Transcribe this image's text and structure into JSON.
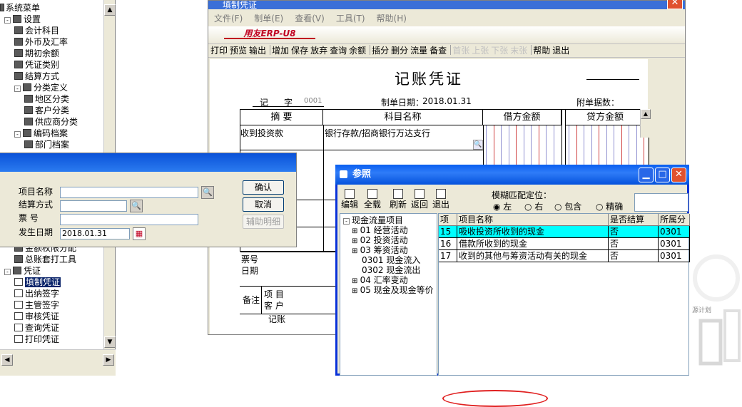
{
  "tree": {
    "root": "系统菜单",
    "items": [
      {
        "label": "设置",
        "indent": 0,
        "type": "folder",
        "expander": "-"
      },
      {
        "label": "会计科目",
        "indent": 1,
        "type": "item"
      },
      {
        "label": "外币及汇率",
        "indent": 1,
        "type": "item"
      },
      {
        "label": "期初余额",
        "indent": 1,
        "type": "item"
      },
      {
        "label": "凭证类别",
        "indent": 1,
        "type": "item"
      },
      {
        "label": "结算方式",
        "indent": 1,
        "type": "item"
      },
      {
        "label": "分类定义",
        "indent": 1,
        "type": "folder",
        "expander": "-"
      },
      {
        "label": "地区分类",
        "indent": 2,
        "type": "item"
      },
      {
        "label": "客户分类",
        "indent": 2,
        "type": "item"
      },
      {
        "label": "供应商分类",
        "indent": 2,
        "type": "item"
      },
      {
        "label": "编码档案",
        "indent": 1,
        "type": "folder",
        "expander": "-"
      },
      {
        "label": "部门档案",
        "indent": 2,
        "type": "item"
      }
    ],
    "lower_items": [
      {
        "label": "金额权限分配",
        "indent": 1,
        "type": "item"
      },
      {
        "label": "总账套打工具",
        "indent": 1,
        "type": "item"
      },
      {
        "label": "凭证",
        "indent": 0,
        "type": "folder",
        "expander": "-"
      },
      {
        "label": "填制凭证",
        "indent": 1,
        "type": "doc",
        "selected": true
      },
      {
        "label": "出纳签字",
        "indent": 1,
        "type": "doc"
      },
      {
        "label": "主管签字",
        "indent": 1,
        "type": "doc"
      },
      {
        "label": "审核凭证",
        "indent": 1,
        "type": "doc"
      },
      {
        "label": "查询凭证",
        "indent": 1,
        "type": "doc"
      },
      {
        "label": "打印凭证",
        "indent": 1,
        "type": "doc"
      }
    ]
  },
  "voucher_window": {
    "title": "填制凭证",
    "menu": [
      "文件(F)",
      "制单(E)",
      "查看(V)",
      "工具(T)",
      "帮助(H)"
    ],
    "brand": "用友ERP-U8",
    "toolbar": [
      {
        "label": "打印",
        "enabled": true
      },
      {
        "label": "预览",
        "enabled": true
      },
      {
        "label": "输出",
        "enabled": true
      },
      {
        "label": "增加",
        "enabled": true
      },
      {
        "label": "保存",
        "enabled": true
      },
      {
        "label": "放弃",
        "enabled": true
      },
      {
        "label": "查询",
        "enabled": true
      },
      {
        "label": "余额",
        "enabled": true
      },
      {
        "label": "插分",
        "enabled": true
      },
      {
        "label": "删分",
        "enabled": true
      },
      {
        "label": "流量",
        "enabled": true
      },
      {
        "label": "备查",
        "enabled": true
      },
      {
        "label": "首张",
        "enabled": false
      },
      {
        "label": "上张",
        "enabled": false
      },
      {
        "label": "下张",
        "enabled": false
      },
      {
        "label": "末张",
        "enabled": false
      },
      {
        "label": "帮助",
        "enabled": true
      },
      {
        "label": "退出",
        "enabled": true
      }
    ],
    "heading": "记账凭证",
    "voucher_type": "记",
    "voucher_char": "字",
    "voucher_no": "0001",
    "date_label": "制单日期：",
    "date": "2018.01.31",
    "attachments_label": "附单据数：",
    "columns": {
      "summary": "摘 要",
      "subject": "科目名称",
      "debit": "借方金额",
      "credit": "贷方金额"
    },
    "row1": {
      "summary": "收到投资款",
      "subject": "银行存款/招商银行万达支行"
    },
    "footer": {
      "bill_no": "票号",
      "date": "日期",
      "remark": "备注",
      "project": "项 目",
      "customer": "客 户",
      "bookkeeper": "记账"
    }
  },
  "project_dialog": {
    "fields": {
      "project_name": "项目名称",
      "settle_method": "结算方式",
      "bill_no": "票 号",
      "occur_date": "发生日期",
      "occur_date_value": "2018.01.31"
    },
    "buttons": {
      "ok": "确认",
      "cancel": "取消",
      "aux": "辅助明细"
    }
  },
  "reference_dialog": {
    "title": "参照",
    "toolbar": [
      "编辑",
      "全载",
      "刷新",
      "返回",
      "退出"
    ],
    "match_label": "模糊匹配定位：",
    "match_options": [
      {
        "label": "左",
        "checked": true
      },
      {
        "label": "右",
        "checked": false
      },
      {
        "label": "包含",
        "checked": false
      },
      {
        "label": "精确",
        "checked": false
      }
    ],
    "tree": {
      "root": "现金流量项目",
      "nodes": [
        {
          "label": "01 经营活动",
          "level": 1
        },
        {
          "label": "02 投资活动",
          "level": 1
        },
        {
          "label": "03 筹资活动",
          "level": 1
        },
        {
          "label": "0301 现金流入",
          "level": 2
        },
        {
          "label": "0302 现金流出",
          "level": 2
        },
        {
          "label": "04 汇率变动",
          "level": 1
        },
        {
          "label": "05 现金及现金等价",
          "level": 1
        }
      ]
    },
    "table": {
      "headers": [
        "项目",
        "项目名称",
        "是否结算",
        "所属分"
      ],
      "rows": [
        {
          "code": "15",
          "name": "吸收投资所收到的现金",
          "settle": "否",
          "category": "0301",
          "selected": true
        },
        {
          "code": "16",
          "name": "借款所收到的现金",
          "settle": "否",
          "category": "0301",
          "selected": false
        },
        {
          "code": "17",
          "name": "收到的其他与筹资活动有关的现金",
          "settle": "否",
          "category": "0301",
          "selected": false
        }
      ]
    }
  },
  "watermark": "源计划",
  "colors": {
    "selection": "#0a246a",
    "highlight_row": "#00ffff",
    "annotation_oval": "#e02020",
    "xp_title": "#0a5ff0"
  }
}
